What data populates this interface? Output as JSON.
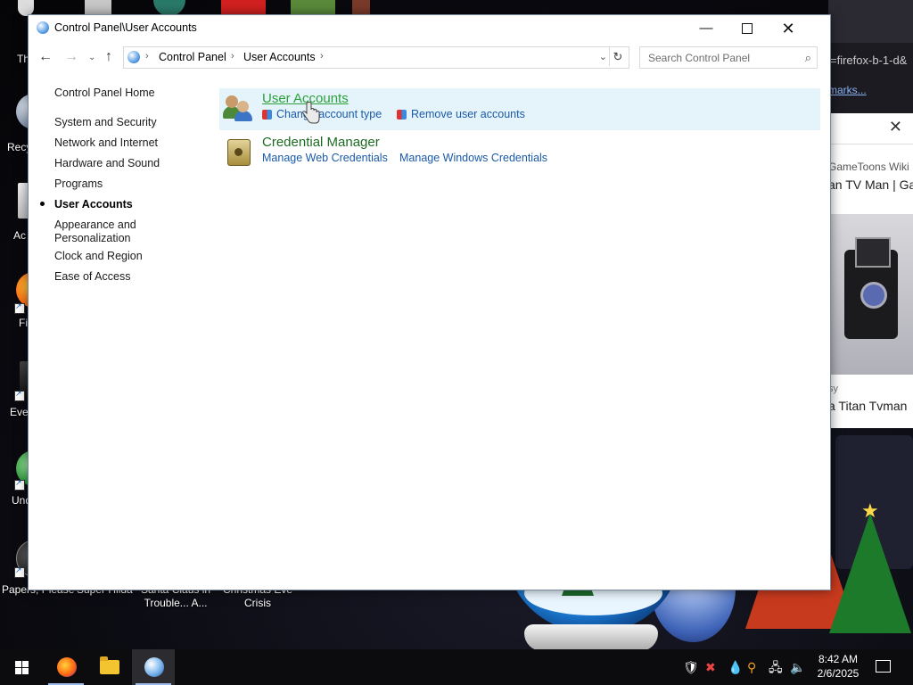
{
  "window": {
    "title": "Control Panel\\User Accounts",
    "minimize_label": "—",
    "close_label": "✕"
  },
  "navbar": {
    "back_glyph": "←",
    "forward_glyph": "→",
    "recent_glyph": "⌄",
    "up_glyph": "↑",
    "breadcrumb": [
      "Control Panel",
      "User Accounts"
    ],
    "refresh_glyph": "↻",
    "search_placeholder": "Search Control Panel"
  },
  "sidebar": {
    "items": [
      {
        "label": "Control Panel Home"
      },
      {
        "label": "System and Security"
      },
      {
        "label": "Network and Internet"
      },
      {
        "label": "Hardware and Sound"
      },
      {
        "label": "Programs"
      },
      {
        "label": "User Accounts",
        "active": true
      },
      {
        "label": "Appearance and\nPersonalization"
      },
      {
        "label": "Clock and Region"
      },
      {
        "label": "Ease of Access"
      }
    ]
  },
  "categories": [
    {
      "title": "User Accounts",
      "icon": "users-icon",
      "tasks": [
        "Change account type",
        "Remove user accounts"
      ]
    },
    {
      "title": "Credential Manager",
      "icon": "safe-icon",
      "tasks": [
        "Manage Web Credentials",
        "Manage Windows Credentials"
      ]
    }
  ],
  "desktop": {
    "icon_labels": [
      "Th",
      "Recy",
      "Ac",
      "Fi",
      "Eve",
      "Und"
    ],
    "bottom_labels": [
      "Papers, Please",
      "Super Hilda",
      "Santa Claus in\nTrouble... A...",
      "Christmas Eve\nCrisis"
    ]
  },
  "background_browser": {
    "url_fragment": "=firefox-b-1-d&",
    "bookmarks_fragment": "marks...",
    "close_glyph": "✕",
    "source1": "GameToons Wiki",
    "title1": "an TV Man | Ga",
    "source2": "sy",
    "title2": "a Titan Tvman"
  },
  "taskbar": {
    "clock_time": "8:42 AM",
    "clock_date": "2/6/2025"
  },
  "colors": {
    "category_title": "#1d6b22",
    "category_title_hover": "#2aa13a",
    "task_link": "#1a5aa8",
    "highlight_bg": "#e5f3fb"
  }
}
